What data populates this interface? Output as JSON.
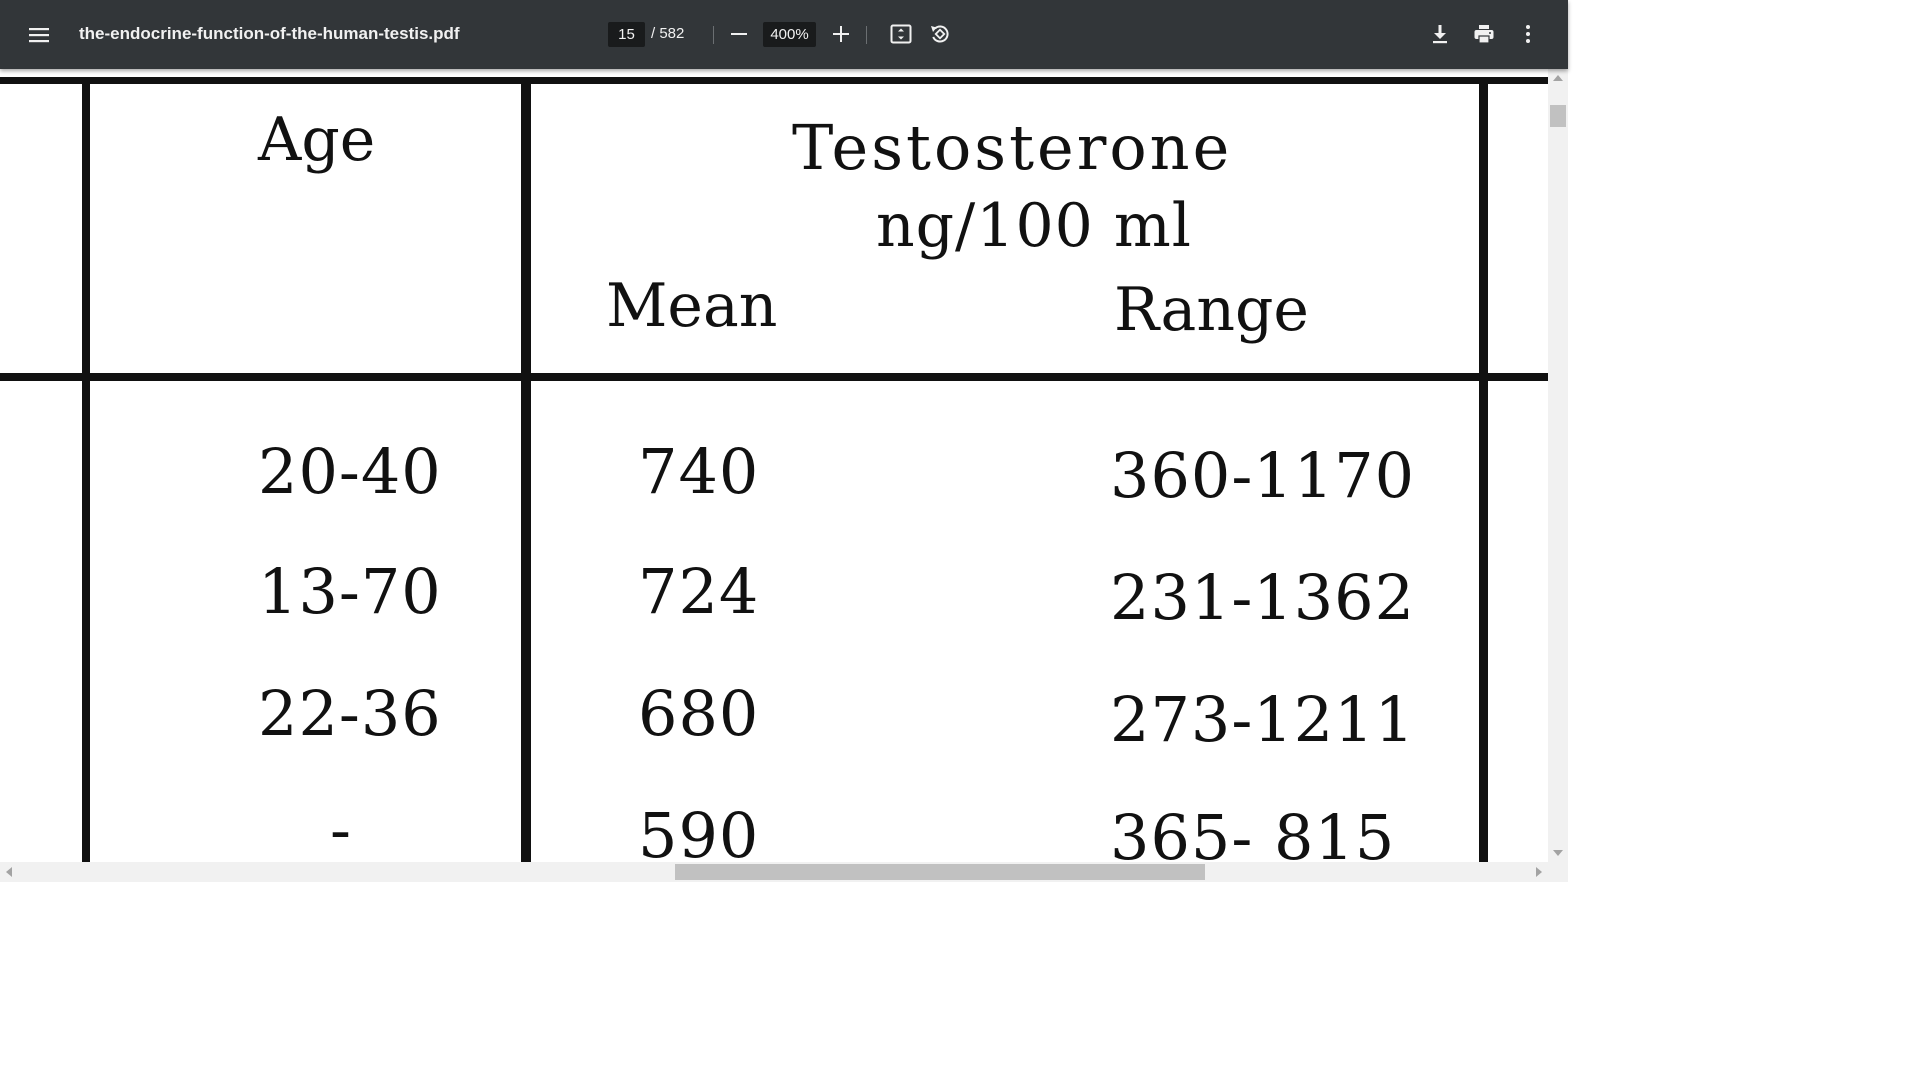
{
  "toolbar": {
    "menu_icon": "hamburger-menu-icon",
    "title": "the-endocrine-function-of-the-human-testis.pdf",
    "page_current": "15",
    "page_total": "/ 582",
    "zoom_level": "400%",
    "icons": {
      "zoom_out": "minus-icon",
      "zoom_in": "plus-icon",
      "fit": "fit-to-page-icon",
      "rotate": "rotate-counterclockwise-icon",
      "download": "download-icon",
      "print": "print-icon",
      "more": "more-vertical-icon"
    },
    "background_color": "#323639",
    "text_color": "#f1f1f1"
  },
  "document": {
    "table": {
      "header": {
        "age": "Age",
        "measure": "Testosterone",
        "unit": "ng/100 ml",
        "mean": "Mean",
        "range": "Range"
      },
      "rows": [
        {
          "age": "20-40",
          "mean": "740",
          "range": "360-1170"
        },
        {
          "age": "13-70",
          "mean": "724",
          "range": "231-1362"
        },
        {
          "age": "22-36",
          "mean": "680",
          "range": "273-1211"
        },
        {
          "age": "-",
          "mean": "590",
          "range": "365- 815"
        }
      ]
    }
  },
  "scrollbars": {
    "vertical": {
      "position_fraction": 0.02
    },
    "horizontal": {
      "position_fraction": 0.44
    }
  }
}
